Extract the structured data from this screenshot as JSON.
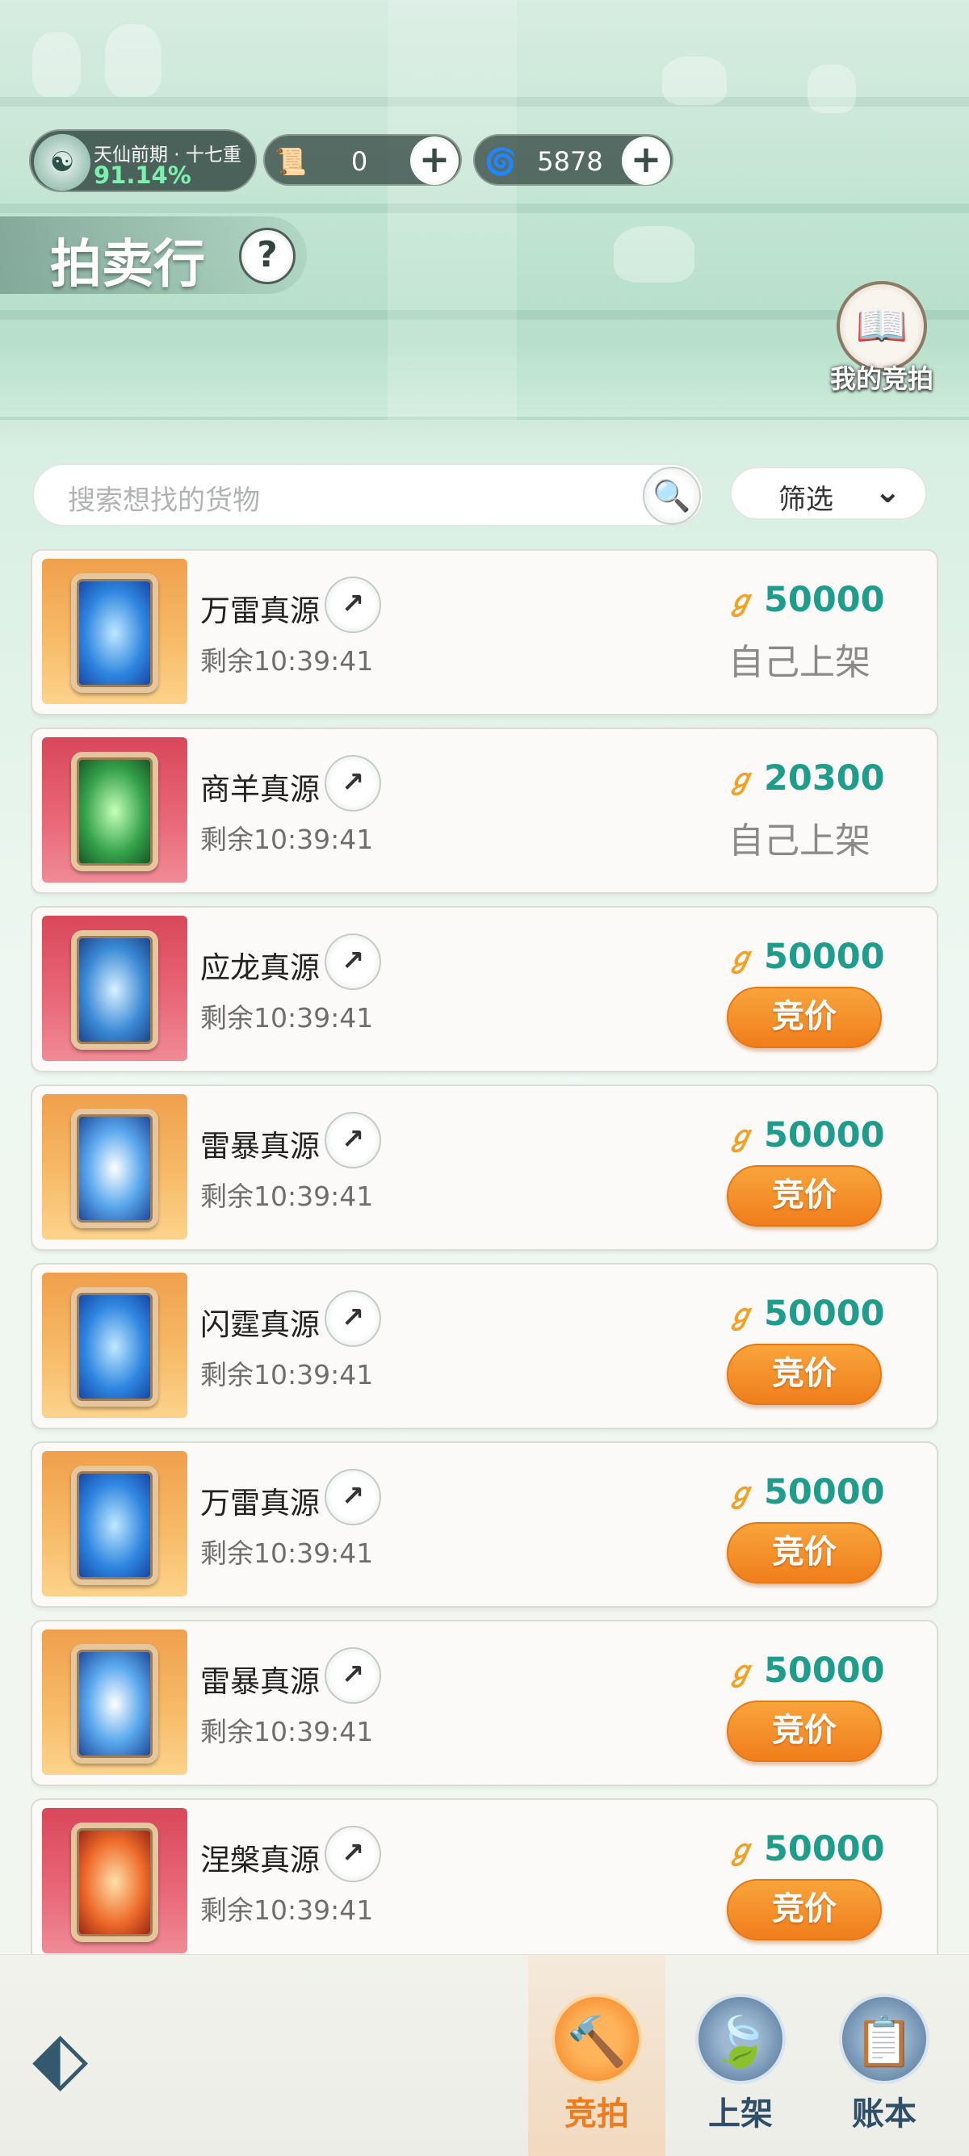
{
  "header": {
    "realm_name": "天仙前期 · 十七重",
    "realm_progress": "91.14%",
    "resources": [
      {
        "name": "scroll-currency",
        "value": "0"
      },
      {
        "name": "spirit-stone-currency",
        "value": "5878"
      }
    ],
    "title": "拍卖行",
    "help_label": "?",
    "my_bids_label": "我的竞拍"
  },
  "search": {
    "placeholder": "搜索想找的货物",
    "filter_label": "筛选"
  },
  "items": [
    {
      "name": "万雷真源",
      "remaining": "剩余10:39:41",
      "price": "50000",
      "status": "自己上架",
      "own": true,
      "bg": "gold",
      "card": "lightning"
    },
    {
      "name": "商羊真源",
      "remaining": "剩余10:39:41",
      "price": "20300",
      "status": "自己上架",
      "own": true,
      "bg": "red",
      "card": "leaf"
    },
    {
      "name": "应龙真源",
      "remaining": "剩余10:39:41",
      "price": "50000",
      "status": "竞价",
      "own": false,
      "bg": "red",
      "card": "dragon"
    },
    {
      "name": "雷暴真源",
      "remaining": "剩余10:39:41",
      "price": "50000",
      "status": "竞价",
      "own": false,
      "bg": "gold",
      "card": "storm"
    },
    {
      "name": "闪霆真源",
      "remaining": "剩余10:39:41",
      "price": "50000",
      "status": "竞价",
      "own": false,
      "bg": "gold",
      "card": "lightning"
    },
    {
      "name": "万雷真源",
      "remaining": "剩余10:39:41",
      "price": "50000",
      "status": "竞价",
      "own": false,
      "bg": "gold",
      "card": "lightning"
    },
    {
      "name": "雷暴真源",
      "remaining": "剩余10:39:41",
      "price": "50000",
      "status": "竞价",
      "own": false,
      "bg": "gold",
      "card": "storm"
    },
    {
      "name": "涅槃真源",
      "remaining": "剩余10:39:41",
      "price": "50000",
      "status": "竞价",
      "own": false,
      "bg": "red",
      "card": "fire"
    }
  ],
  "nav": [
    {
      "label": "竞拍",
      "icon": "gavel-icon",
      "active": true
    },
    {
      "label": "上架",
      "icon": "shelf-icon",
      "active": false
    },
    {
      "label": "账本",
      "icon": "ledger-icon",
      "active": false
    }
  ],
  "colors": {
    "price": "#1f9d8c",
    "bid_button": "#f07e1b",
    "active_nav": "#ef7c1a"
  }
}
